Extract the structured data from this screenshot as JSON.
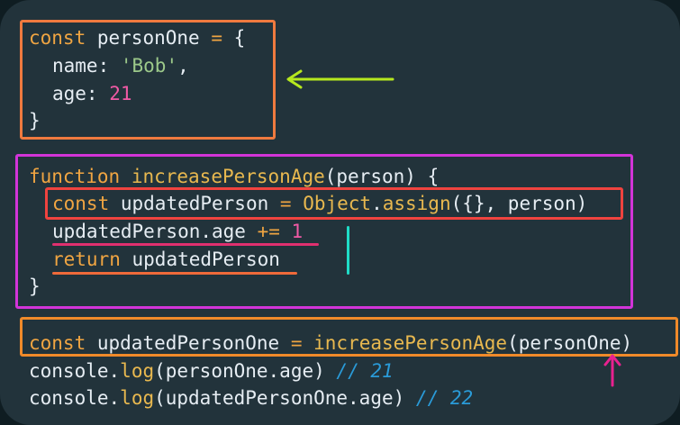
{
  "code": {
    "l1": {
      "kw": "const",
      "name": "personOne",
      "eq": "=",
      "brace": "{"
    },
    "l2": {
      "key": "name:",
      "val": "'Bob'",
      "comma": ","
    },
    "l3": {
      "key": "age:",
      "val": "21"
    },
    "l4": {
      "brace": "}"
    },
    "l5": {
      "kw": "function",
      "fn": "increasePersonAge",
      "params": "(person)",
      "brace": "{"
    },
    "l6": {
      "kw": "const",
      "name": "updatedPerson",
      "eq": "=",
      "obj": "Object",
      "dot": ".",
      "method": "assign",
      "args": "({}, person)"
    },
    "l7": {
      "expr": "updatedPerson.age",
      "op": "+=",
      "num": "1"
    },
    "l8": {
      "kw": "return",
      "val": "updatedPerson"
    },
    "l9": {
      "brace": "}"
    },
    "l10": {
      "kw": "const",
      "name": "updatedPersonOne",
      "eq": "=",
      "fn": "increasePersonAge",
      "args": "(personOne)"
    },
    "l11": {
      "obj": "console",
      "dot": ".",
      "method": "log",
      "args": "(personOne.age)",
      "comment": "// 21"
    },
    "l12": {
      "obj": "console",
      "dot": ".",
      "method": "log",
      "args": "(updatedPersonOne.age)",
      "comment": "// 22"
    }
  },
  "colors": {
    "keyword": "#f0a542",
    "string": "#9cc98a",
    "number": "#f05aa5",
    "comment": "#2a9bd8",
    "box_orange": "#f07a3f",
    "box_magenta": "#d234d8",
    "box_red": "#f0433f",
    "arrow_green": "#b6e81e",
    "arrow_pink": "#e8218f",
    "cursor": "#1fdcc7"
  },
  "annotations": {
    "arrow_left": "green-arrow-icon",
    "arrow_up": "pink-arrow-icon"
  }
}
